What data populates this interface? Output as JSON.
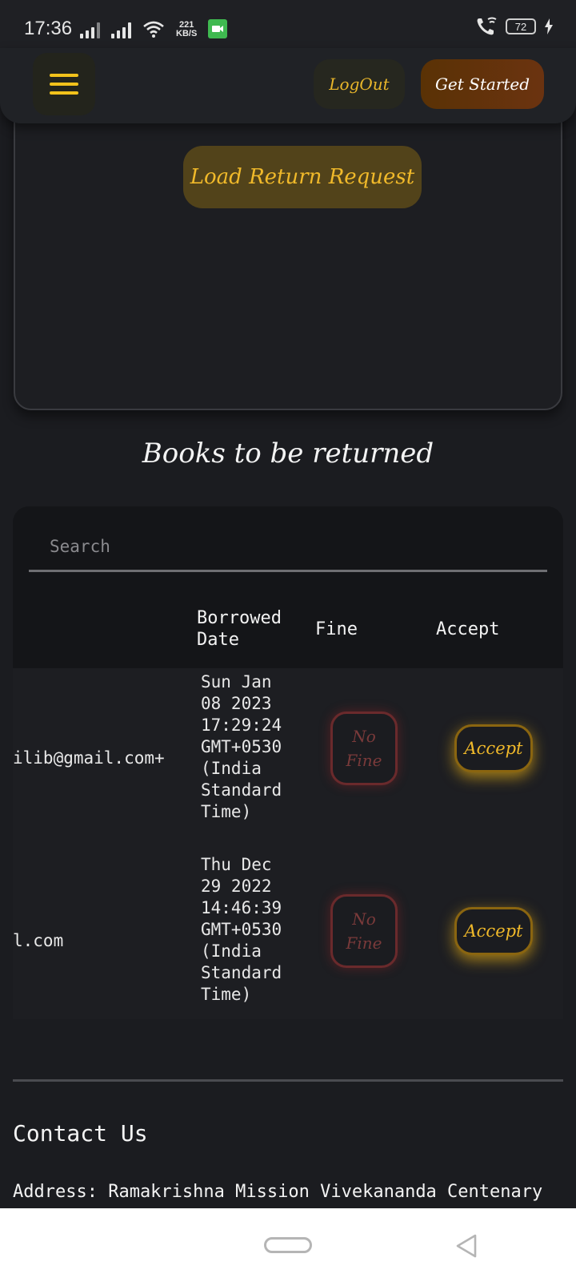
{
  "status_bar": {
    "time": "17:36",
    "net_speed_value": "221",
    "net_speed_unit": "KB/S",
    "battery": "72"
  },
  "header": {
    "logout_label": "LogOut",
    "get_started_label": "Get Started"
  },
  "card": {
    "load_button_label": "Load Return Request"
  },
  "section": {
    "title": "Books to be returned"
  },
  "search": {
    "placeholder": "Search"
  },
  "table": {
    "columns": [
      "Borrowed Date",
      "Fine",
      "Accept"
    ],
    "rows": [
      {
        "email": "+ilib@gmail.com",
        "date_lines": [
          "Sun Jan",
          "08 2023",
          "17:29:24",
          "GMT+0530",
          "(India",
          "Standard",
          "Time)"
        ],
        "fine_label": "No Fine",
        "accept_label": "Accept"
      },
      {
        "email": "l.com",
        "date_lines": [
          "Thu Dec",
          "29 2022",
          "14:46:39",
          "GMT+0530",
          "(India",
          "Standard",
          "Time)"
        ],
        "fine_label": "No Fine",
        "accept_label": "Accept"
      }
    ]
  },
  "contact": {
    "title": "Contact Us",
    "address": "Address: Ramakrishna Mission Vivekananda Centenary"
  },
  "colors": {
    "accent": "#f0b92a",
    "background": "#1b1c20"
  }
}
